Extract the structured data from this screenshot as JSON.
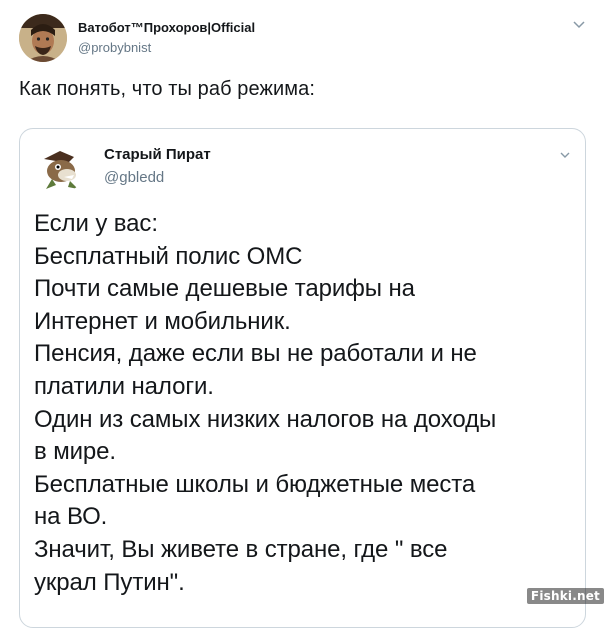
{
  "tweet": {
    "author_name": "Ватобот™Прохоров|Official",
    "author_handle": "@probybnist",
    "text": "Как понять, что ты раб режима:",
    "menu_icon": "chevron-down-icon"
  },
  "quoted_tweet": {
    "author_name": "Старый Пират",
    "author_handle": "@gbledd",
    "menu_icon": "chevron-down-icon",
    "lines": [
      "Если у вас:",
      "Бесплатный полис ОМС",
      "Почти самые дешевые тарифы на",
      "Интернет и мобильник.",
      "Пенсия, даже если вы не работали и не",
      "платили налоги.",
      "Один из самых низких налогов на доходы",
      "в мире.",
      "Бесплатные школы и бюджетные места",
      "на ВО.",
      "Значит, Вы живете в стране, где \" все",
      "украл Путин\"."
    ]
  },
  "watermark": "Fishki.net",
  "colors": {
    "text": "#14171a",
    "secondary": "#657786",
    "border": "#cdd6dd",
    "background": "#ffffff"
  }
}
